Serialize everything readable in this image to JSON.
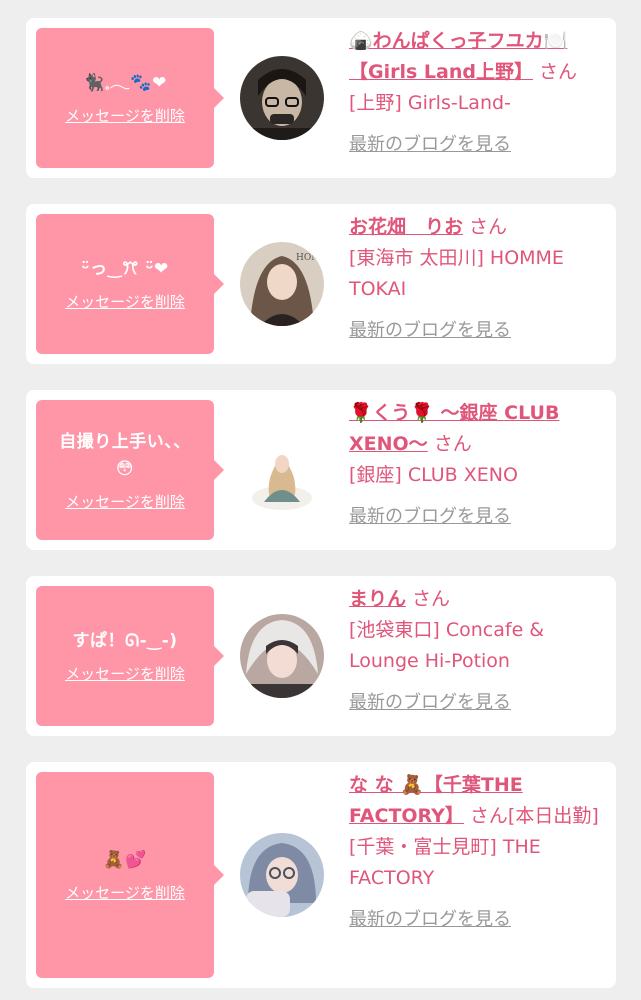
{
  "entries": [
    {
      "message": "🐈‍⬛𓈒𓂃🐾❤︎",
      "delete_label": "メッセージを削除",
      "name": "🍙わんぱくっ子フユカ🍽️【Girls Land上野】",
      "honorific": "さん",
      "shop": "[上野] Girls-Land-",
      "blog_label": "最新のブログを見る",
      "avatar_colors": [
        "#3a3530",
        "#c9b7a6",
        "#1a1614"
      ]
    },
    {
      "message": "ᵕ̈っ‿ꔫ ᵕ̈❤︎",
      "delete_label": "メッセージを削除",
      "name": "お花畑　りお",
      "honorific": "さん",
      "shop": "[東海市 太田川] HOMME TOKAI",
      "blog_label": "最新のブログを見る",
      "avatar_colors": [
        "#d8cfc2",
        "#6b5648",
        "#2a2220"
      ]
    },
    {
      "message": "自撮り上手い、、😳",
      "delete_label": "メッセージを削除",
      "name": "🌹くう🌹 〜銀座 CLUB XENO〜",
      "honorific": "さん",
      "shop": "[銀座] CLUB XENO",
      "blog_label": "最新のブログを見る",
      "avatar_colors": [
        "#f3f0ec",
        "#d9b98f",
        "#6e8f8a"
      ]
    },
    {
      "message": "すぱ！ᘏ-‿-)",
      "delete_label": "メッセージを削除",
      "name": "まりん",
      "honorific": "さん",
      "shop": "[池袋東口] Concafe & Lounge Hi-Potion",
      "blog_label": "最新のブログを見る",
      "avatar_colors": [
        "#e9e6e6",
        "#3b3434",
        "#b9a7a2"
      ]
    },
    {
      "message": "🧸💕",
      "delete_label": "メッセージを削除",
      "name": "な な 🧸【千葉THE FACTORY】",
      "honorific": "さん[本日出勤]",
      "shop": "[千葉・富士見町] THE FACTORY",
      "blog_label": "最新のブログを見る",
      "avatar_colors": [
        "#b7c4d6",
        "#e7e3ea",
        "#4a5160"
      ]
    }
  ],
  "theme": {
    "accent": "#e0557a",
    "bubble": "#ff96a8",
    "muted": "#999999"
  }
}
